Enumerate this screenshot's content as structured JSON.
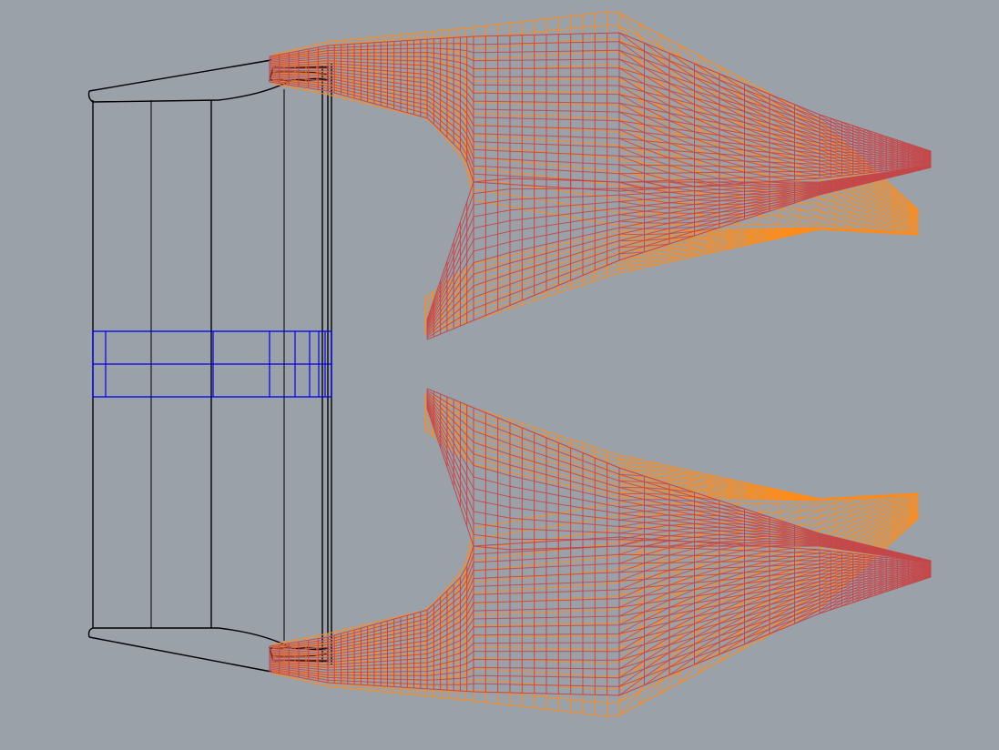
{
  "viewport": {
    "background": "#9aa1a9"
  },
  "colors": {
    "body_outline": "#000000",
    "center_section": "#0000ee",
    "mesh_primary": "#c4474a",
    "mesh_secondary": "#ff8c1a"
  },
  "parts": [
    {
      "name": "fuselage-body",
      "color": "#000000"
    },
    {
      "name": "center-section",
      "color": "#0000ee"
    },
    {
      "name": "upper-tail-mesh",
      "color": "#c4474a"
    },
    {
      "name": "lower-tail-mesh",
      "color": "#c4474a"
    },
    {
      "name": "upper-tail-mesh-deformed",
      "color": "#ff8c1a"
    },
    {
      "name": "lower-tail-mesh-deformed",
      "color": "#ff8c1a"
    }
  ]
}
